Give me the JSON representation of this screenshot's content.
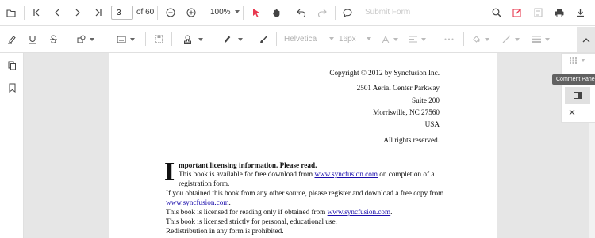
{
  "toolbar": {
    "current_page": "3",
    "total_pages_label": "of 60",
    "zoom_level": "100%",
    "submit_form_label": "Submit Form"
  },
  "annotation_toolbar": {
    "font_family": "Helvetica",
    "font_size": "16px"
  },
  "comment_panel": {
    "tooltip": "Comment Panel"
  },
  "document": {
    "copyright": "Copyright © 2012 by Syncfusion Inc.",
    "address_lines": [
      "2501 Aerial Center Parkway",
      "Suite 200",
      "Morrisville, NC 27560",
      "USA"
    ],
    "rights": "All rights reserved.",
    "dropcap": "I",
    "heading_rest": "mportant licensing information. Please read.",
    "line1_a": "This book is available for free download from ",
    "link": "www.syncfusion.com",
    "line1_b": " on completion of a",
    "line2": "registration form.",
    "line3": "If you obtained this book from any other source, please register and download a free copy from",
    "line4_link": "www.syncfusion.com",
    "line4_end": ".",
    "line5_a": "This book is licensed for reading only if obtained from ",
    "line5_link": "www.syncfusion.com",
    "line5_end": ".",
    "line6": "This book is licensed strictly for personal, educational use.",
    "line7": "Redistribution in any form is prohibited."
  },
  "colors": {
    "accent_red": "#e8384f",
    "link_blue": "#1a0dab",
    "viewer_bg": "#e6e6e6"
  }
}
